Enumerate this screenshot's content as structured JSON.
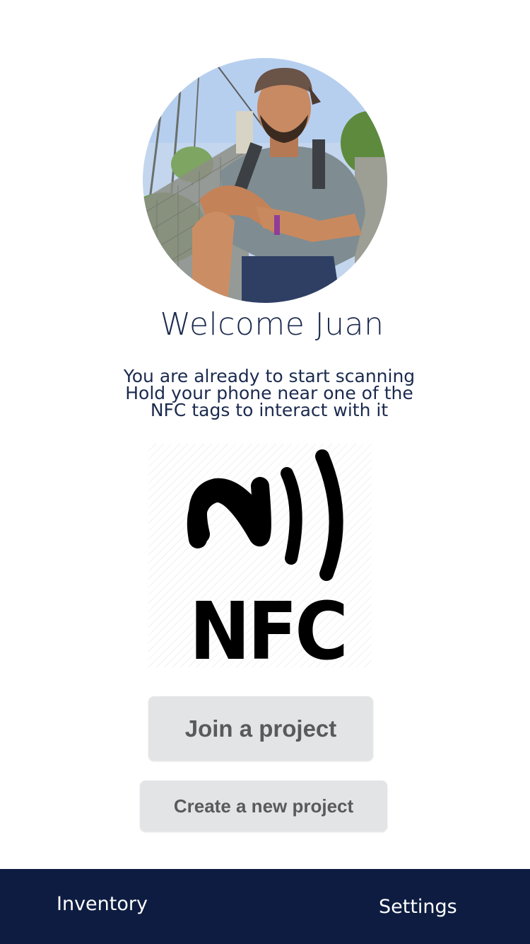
{
  "profile": {
    "avatar_alt": "Juan"
  },
  "welcome": {
    "title": "Welcome Juan"
  },
  "instructions": {
    "lines": [
      "You are already to start scanning",
      "Hold your phone near one of the",
      "NFC tags to interact with it"
    ]
  },
  "nfc": {
    "icon": "nfc-icon",
    "label": "NFC"
  },
  "actions": {
    "join_label": "Join a project",
    "create_label": "Create a new project"
  },
  "nav": {
    "inventory_label": "Inventory",
    "settings_label": "Settings"
  },
  "colors": {
    "primary_navy": "#0d1c40",
    "heading_text": "#1b2a4e",
    "button_bg": "#e3e4e6",
    "button_text": "#5a5a5a"
  }
}
